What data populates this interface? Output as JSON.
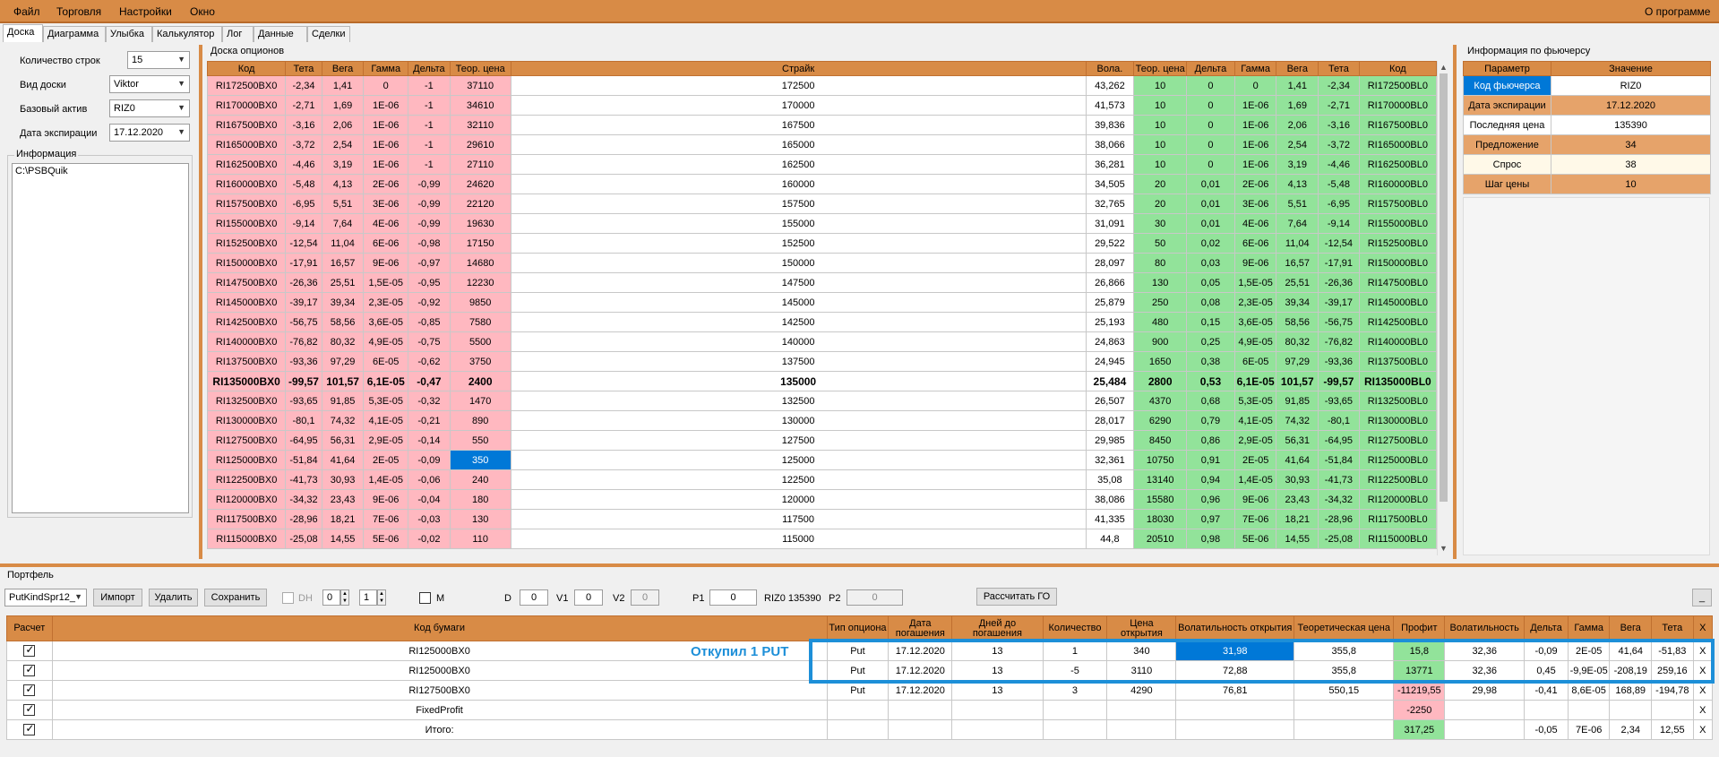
{
  "menu": {
    "items": [
      "Файл",
      "Торговля",
      "Настройки",
      "Окно"
    ],
    "about": "О программе"
  },
  "tabs": [
    "Доска",
    "Диаграмма",
    "Улыбка",
    "Калькулятор",
    "Лог",
    "Данные",
    "Сделки"
  ],
  "left_panel": {
    "rows_count_label": "Количество строк",
    "rows_count_value": "15",
    "board_type_label": "Вид доски",
    "board_type_value": "Viktor",
    "base_asset_label": "Базовый актив",
    "base_asset_value": "RIZ0",
    "expiration_label": "Дата экспирации",
    "expiration_value": "17.12.2020",
    "info_title": "Информация",
    "info_text": "C:\\PSBQuik"
  },
  "board": {
    "title": "Доска опционов",
    "headers": [
      "Код",
      "Тета",
      "Вега",
      "Гамма",
      "Дельта",
      "Теор. цена",
      "Страйк",
      "Вола.",
      "Теор. цена",
      "Дельта",
      "Гамма",
      "Вега",
      "Тета",
      "Код"
    ],
    "rows": [
      [
        "RI172500BX0",
        "-2,34",
        "1,41",
        "0",
        "-1",
        "37110",
        "172500",
        "43,262",
        "10",
        "0",
        "0",
        "1,41",
        "-2,34",
        "RI172500BL0"
      ],
      [
        "RI170000BX0",
        "-2,71",
        "1,69",
        "1E-06",
        "-1",
        "34610",
        "170000",
        "41,573",
        "10",
        "0",
        "1E-06",
        "1,69",
        "-2,71",
        "RI170000BL0"
      ],
      [
        "RI167500BX0",
        "-3,16",
        "2,06",
        "1E-06",
        "-1",
        "32110",
        "167500",
        "39,836",
        "10",
        "0",
        "1E-06",
        "2,06",
        "-3,16",
        "RI167500BL0"
      ],
      [
        "RI165000BX0",
        "-3,72",
        "2,54",
        "1E-06",
        "-1",
        "29610",
        "165000",
        "38,066",
        "10",
        "0",
        "1E-06",
        "2,54",
        "-3,72",
        "RI165000BL0"
      ],
      [
        "RI162500BX0",
        "-4,46",
        "3,19",
        "1E-06",
        "-1",
        "27110",
        "162500",
        "36,281",
        "10",
        "0",
        "1E-06",
        "3,19",
        "-4,46",
        "RI162500BL0"
      ],
      [
        "RI160000BX0",
        "-5,48",
        "4,13",
        "2E-06",
        "-0,99",
        "24620",
        "160000",
        "34,505",
        "20",
        "0,01",
        "2E-06",
        "4,13",
        "-5,48",
        "RI160000BL0"
      ],
      [
        "RI157500BX0",
        "-6,95",
        "5,51",
        "3E-06",
        "-0,99",
        "22120",
        "157500",
        "32,765",
        "20",
        "0,01",
        "3E-06",
        "5,51",
        "-6,95",
        "RI157500BL0"
      ],
      [
        "RI155000BX0",
        "-9,14",
        "7,64",
        "4E-06",
        "-0,99",
        "19630",
        "155000",
        "31,091",
        "30",
        "0,01",
        "4E-06",
        "7,64",
        "-9,14",
        "RI155000BL0"
      ],
      [
        "RI152500BX0",
        "-12,54",
        "11,04",
        "6E-06",
        "-0,98",
        "17150",
        "152500",
        "29,522",
        "50",
        "0,02",
        "6E-06",
        "11,04",
        "-12,54",
        "RI152500BL0"
      ],
      [
        "RI150000BX0",
        "-17,91",
        "16,57",
        "9E-06",
        "-0,97",
        "14680",
        "150000",
        "28,097",
        "80",
        "0,03",
        "9E-06",
        "16,57",
        "-17,91",
        "RI150000BL0"
      ],
      [
        "RI147500BX0",
        "-26,36",
        "25,51",
        "1,5E-05",
        "-0,95",
        "12230",
        "147500",
        "26,866",
        "130",
        "0,05",
        "1,5E-05",
        "25,51",
        "-26,36",
        "RI147500BL0"
      ],
      [
        "RI145000BX0",
        "-39,17",
        "39,34",
        "2,3E-05",
        "-0,92",
        "9850",
        "145000",
        "25,879",
        "250",
        "0,08",
        "2,3E-05",
        "39,34",
        "-39,17",
        "RI145000BL0"
      ],
      [
        "RI142500BX0",
        "-56,75",
        "58,56",
        "3,6E-05",
        "-0,85",
        "7580",
        "142500",
        "25,193",
        "480",
        "0,15",
        "3,6E-05",
        "58,56",
        "-56,75",
        "RI142500BL0"
      ],
      [
        "RI140000BX0",
        "-76,82",
        "80,32",
        "4,9E-05",
        "-0,75",
        "5500",
        "140000",
        "24,863",
        "900",
        "0,25",
        "4,9E-05",
        "80,32",
        "-76,82",
        "RI140000BL0"
      ],
      [
        "RI137500BX0",
        "-93,36",
        "97,29",
        "6E-05",
        "-0,62",
        "3750",
        "137500",
        "24,945",
        "1650",
        "0,38",
        "6E-05",
        "97,29",
        "-93,36",
        "RI137500BL0"
      ],
      [
        "RI135000BX0",
        "-99,57",
        "101,57",
        "6,1E-05",
        "-0,47",
        "2400",
        "135000",
        "25,484",
        "2800",
        "0,53",
        "6,1E-05",
        "101,57",
        "-99,57",
        "RI135000BL0"
      ],
      [
        "RI132500BX0",
        "-93,65",
        "91,85",
        "5,3E-05",
        "-0,32",
        "1470",
        "132500",
        "26,507",
        "4370",
        "0,68",
        "5,3E-05",
        "91,85",
        "-93,65",
        "RI132500BL0"
      ],
      [
        "RI130000BX0",
        "-80,1",
        "74,32",
        "4,1E-05",
        "-0,21",
        "890",
        "130000",
        "28,017",
        "6290",
        "0,79",
        "4,1E-05",
        "74,32",
        "-80,1",
        "RI130000BL0"
      ],
      [
        "RI127500BX0",
        "-64,95",
        "56,31",
        "2,9E-05",
        "-0,14",
        "550",
        "127500",
        "29,985",
        "8450",
        "0,86",
        "2,9E-05",
        "56,31",
        "-64,95",
        "RI127500BL0"
      ],
      [
        "RI125000BX0",
        "-51,84",
        "41,64",
        "2E-05",
        "-0,09",
        "350",
        "125000",
        "32,361",
        "10750",
        "0,91",
        "2E-05",
        "41,64",
        "-51,84",
        "RI125000BL0"
      ],
      [
        "RI122500BX0",
        "-41,73",
        "30,93",
        "1,4E-05",
        "-0,06",
        "240",
        "122500",
        "35,08",
        "13140",
        "0,94",
        "1,4E-05",
        "30,93",
        "-41,73",
        "RI122500BL0"
      ],
      [
        "RI120000BX0",
        "-34,32",
        "23,43",
        "9E-06",
        "-0,04",
        "180",
        "120000",
        "38,086",
        "15580",
        "0,96",
        "9E-06",
        "23,43",
        "-34,32",
        "RI120000BL0"
      ],
      [
        "RI117500BX0",
        "-28,96",
        "18,21",
        "7E-06",
        "-0,03",
        "130",
        "117500",
        "41,335",
        "18030",
        "0,97",
        "7E-06",
        "18,21",
        "-28,96",
        "RI117500BL0"
      ],
      [
        "RI115000BX0",
        "-25,08",
        "14,55",
        "5E-06",
        "-0,02",
        "110",
        "115000",
        "44,8",
        "20510",
        "0,98",
        "5E-06",
        "14,55",
        "-25,08",
        "RI115000BL0"
      ]
    ]
  },
  "futures": {
    "title": "Информация по фьючерсу",
    "headers": [
      "Параметр",
      "Значение"
    ],
    "rows": [
      [
        "Код фьючерса",
        "RIZ0"
      ],
      [
        "Дата экспирации",
        "17.12.2020"
      ],
      [
        "Последняя цена",
        "135390"
      ],
      [
        "Предложение",
        "34"
      ],
      [
        "Спрос",
        "38"
      ],
      [
        "Шаг цены",
        "10"
      ]
    ]
  },
  "portfolio": {
    "title": "Портфель",
    "name_value": "PutKindSpr12_",
    "import_label": "Импорт",
    "delete_label": "Удалить",
    "save_label": "Сохранить",
    "dh_label": "DH",
    "spin1": "0",
    "spin2": "1",
    "m_label": "M",
    "d_label": "D",
    "d_value": "0",
    "v1_label": "V1",
    "v1_value": "0",
    "v2_label": "V2",
    "v2_value": "0",
    "p1_label": "P1",
    "p1_value": "0",
    "riz_text": "RIZ0 135390",
    "p2_label": "P2",
    "p2_value": "0",
    "calc_label": "Рассчитать ГО",
    "min_label": "_",
    "headers": [
      "Расчет",
      "Код бумаги",
      "Тип опциона",
      "Дата погашения",
      "Дней до погашения",
      "Количество",
      "Цена открытия",
      "Волатильность открытия",
      "Теоретическая цена",
      "Профит",
      "Волатильность",
      "Дельта",
      "Гамма",
      "Вега",
      "Тета",
      "X"
    ],
    "rows": [
      [
        "RI125000BX0",
        "Put",
        "17.12.2020",
        "13",
        "1",
        "340",
        "31,98",
        "355,8",
        "15,8",
        "32,36",
        "-0,09",
        "2E-05",
        "41,64",
        "-51,83",
        "X"
      ],
      [
        "RI125000BX0",
        "Put",
        "17.12.2020",
        "13",
        "-5",
        "3110",
        "72,88",
        "355,8",
        "13771",
        "32,36",
        "0,45",
        "-9,9E-05",
        "-208,19",
        "259,16",
        "X"
      ],
      [
        "RI127500BX0",
        "Put",
        "17.12.2020",
        "13",
        "3",
        "4290",
        "76,81",
        "550,15",
        "-11219,55",
        "29,98",
        "-0,41",
        "8,6E-05",
        "168,89",
        "-194,78",
        "X"
      ],
      [
        "FixedProfit",
        "",
        "",
        "",
        "",
        "",
        "",
        "",
        "-2250",
        "",
        "",
        "",
        "",
        "",
        "X"
      ],
      [
        "Итого:",
        "",
        "",
        "",
        "",
        "",
        "",
        "",
        "317,25",
        "",
        "-0,05",
        "7E-06",
        "2,34",
        "12,55",
        "X"
      ]
    ],
    "annotation": "Откупил 1 PUT"
  }
}
